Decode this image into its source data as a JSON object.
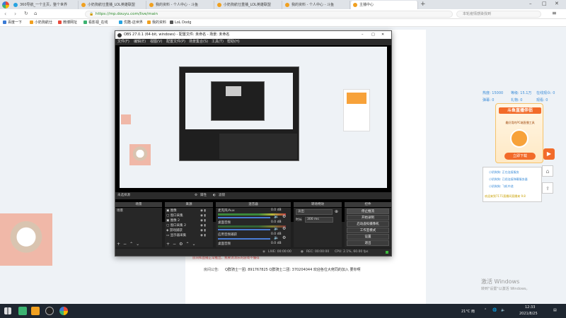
{
  "browser": {
    "tabs": [
      {
        "label": "360导航_一个主页，整个世界",
        "active": false
      },
      {
        "label": "小奶狗航仕重播_LOL英雄联盟",
        "active": false
      },
      {
        "label": "我的资料 - 个人中心 - 斗鱼",
        "active": false
      },
      {
        "label": "小奶狗航仕重播_LOL英雄联盟",
        "active": false
      },
      {
        "label": "我的资料 - 个人中心 - 斗鱼",
        "active": false
      },
      {
        "label": "主播中心",
        "active": true
      }
    ],
    "url": "https://mp.douyu.com/live/main",
    "search_placeholder": "本轮疫情感染找到",
    "bookmarks": [
      "百度一下",
      "小奶狗航仕",
      "微博网址",
      "看影视_在线",
      "优酷-这世界",
      "我的资料",
      "LoL Dodg"
    ]
  },
  "obs": {
    "window_title": "OBS 27.0.1 (64-bit, windows) - 配置文件: 未命名 - 场景: 未命名",
    "menu": [
      "文件(F)",
      "编辑(E)",
      "视图(V)",
      "配置文件(P)",
      "场景集合(S)",
      "工具(T)",
      "帮助(H)"
    ],
    "no_source": "未选择源",
    "props_button": "属性",
    "filters_button": "滤镜",
    "docks": {
      "scenes": "场景",
      "sources": "来源",
      "mixer": "混音器",
      "transitions": "转场特效",
      "controls": "控件"
    },
    "scene_item": "场景",
    "sources": [
      "图像",
      "窗口采集",
      "图像 2",
      "窗口采集 2",
      "游戏捕获",
      "显示器采集"
    ],
    "mixer_channels": [
      {
        "name": "麦克风/Aux",
        "db": "0.0 dB"
      },
      {
        "name": "桌面音频",
        "db": "0.0 dB"
      },
      {
        "name": "应用音频捕获",
        "db": "0.0 dB"
      },
      {
        "name": "桌面音频",
        "db": "0.0 dB"
      }
    ],
    "transition": {
      "type": "淡出",
      "duration_label": "时长",
      "duration": "300 ms"
    },
    "controls": [
      "停止推流",
      "开始录制",
      "启动虚拟摄像机",
      "工作室模式",
      "设置",
      "退出"
    ],
    "status": {
      "live": "LIVE: 00:00:00",
      "rec": "REC: 00:00:00",
      "cpu": "CPU: 2.1%, 60.00 fps"
    }
  },
  "douyu": {
    "stats": [
      "热度: 15000",
      "等级: 15.1万",
      "在线观众: 0",
      "弹幕: 0",
      "礼物: 0",
      "观看: 0"
    ],
    "promo_title": "斗鱼直播伴侣",
    "promo_sub": "最好用的PC端直播工具",
    "promo_button": "立即下载",
    "notice_label": "房间公告:",
    "notice_text": "Q群骑士一团: 891767825 Q群骑士二团: 370204044 欢迎各位大佬同的加入 要你啊",
    "warning": "房间和直播正常推出，我要消消乐的游戏不懂得",
    "chat_lines": [
      "小奶狗狗: 正在连接服务",
      "小奶狗狗: 已经连接弹幕服务器",
      "小奶狗狗: 飞机中途",
      "欢迎来到7171直播间直播来 9.8"
    ]
  },
  "windows": {
    "activate_title": "激活 Windows",
    "activate_sub": "转到\"设置\"以激活 Windows。"
  },
  "taskbar": {
    "weather": "21°C 雨",
    "time": "12:33",
    "date": "2021/8/25"
  }
}
